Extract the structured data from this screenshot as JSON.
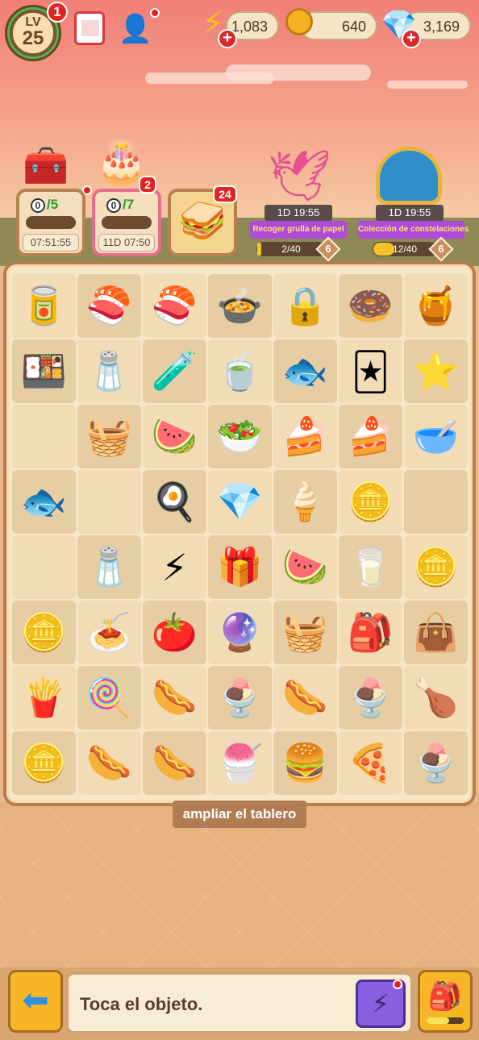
{
  "header": {
    "level_label": "LV",
    "level": "25",
    "level_badge": "1",
    "energy": "1,083",
    "coins": "640",
    "gems": "3,169"
  },
  "orders": [
    {
      "count": "0",
      "target": "/5",
      "time": "07:51:55",
      "badge": ""
    },
    {
      "count": "0",
      "target": "/7",
      "time": "11D 07:50",
      "badge": "2"
    },
    {
      "badge": "24"
    }
  ],
  "events": [
    {
      "timer": "1D 19:55",
      "title": "Recoger grulla de papel",
      "progress": "2/40",
      "progress_value": 0.05,
      "reward": "6"
    },
    {
      "timer": "1D 19:55",
      "title": "Colección de constelaciones",
      "progress": "12/40",
      "progress_value": 0.3,
      "reward": "6"
    }
  ],
  "board": {
    "rows": [
      [
        "🥫",
        "🍣",
        "🍣",
        "🍲",
        "🔒",
        "🍩",
        "🍯"
      ],
      [
        "🍱",
        "🧂",
        "🧪",
        "🍵",
        "🐟",
        "🃏",
        "⭐"
      ],
      [
        "",
        "🧺",
        "🍉",
        "🥗",
        "🍰",
        "🍰",
        "🥣"
      ],
      [
        "🐟",
        "",
        "🍳",
        "💎",
        "🍦",
        "🪙",
        ""
      ],
      [
        "",
        "🧂",
        "⚡",
        "🎁",
        "🍉",
        "🥛",
        "🪙"
      ],
      [
        "🪙",
        "🍝",
        "🍅",
        "🔮",
        "🧺",
        "🎒",
        "👜"
      ],
      [
        "🍟",
        "🍭",
        "🌭",
        "🍨",
        "🌭",
        "🍨",
        "🍗"
      ],
      [
        "🪙",
        "🌭",
        "🌭",
        "🍧",
        "🍔",
        "🍕",
        "🍨"
      ]
    ]
  },
  "expand_label": "ampliar el tablero",
  "bottom": {
    "info_text": "Toca el objeto."
  }
}
